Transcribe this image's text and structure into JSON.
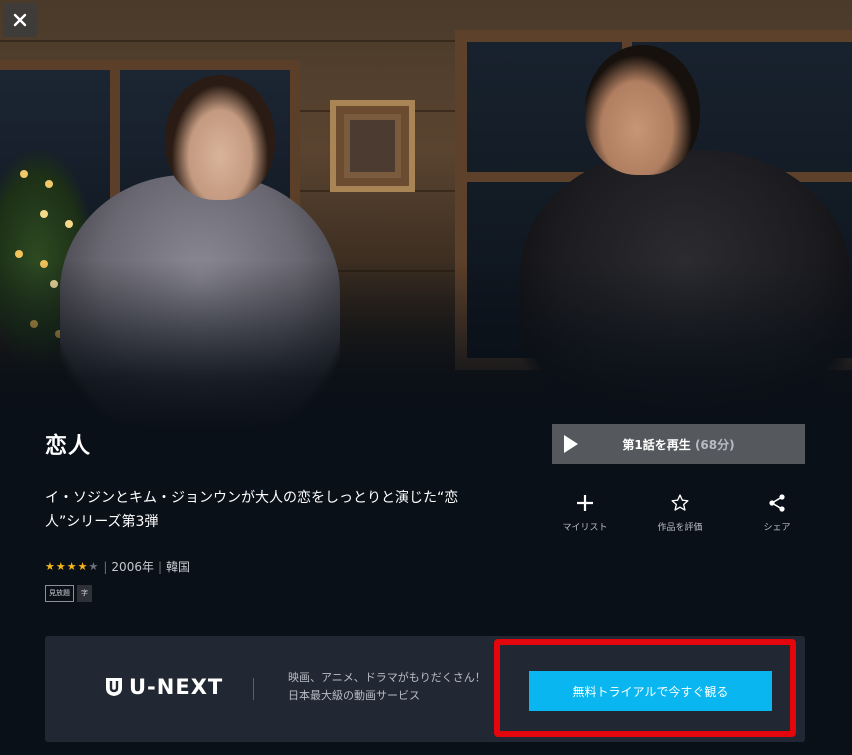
{
  "hero": {
    "scene": "still-image-two-people"
  },
  "close_icon": "close-icon",
  "title": "恋人",
  "play": {
    "label": "第1話を再生",
    "duration": "(68分)"
  },
  "description": "イ・ソジンとキム・ジョンウンが大人の恋をしっとりと演じた“恋人”シリーズ第3弾",
  "actions": [
    {
      "label": "マイリスト",
      "icon": "plus-icon"
    },
    {
      "label": "作品を評価",
      "icon": "star-outline-icon"
    },
    {
      "label": "シェア",
      "icon": "share-icon"
    }
  ],
  "meta": {
    "rating": 4,
    "rating_max": 5,
    "year": "2006年",
    "country": "韓国"
  },
  "badges": [
    "見放題",
    "字"
  ],
  "promo": {
    "brand": "U-NEXT",
    "line1": "映画、アニメ、ドラマがもりだくさん！",
    "line2": "日本最大級の動画サービス",
    "cta": "無料トライアルで今すぐ観る"
  },
  "colors": {
    "cta": "#09b6ef",
    "highlight": "#e3060d",
    "star": "#f5b51b"
  }
}
